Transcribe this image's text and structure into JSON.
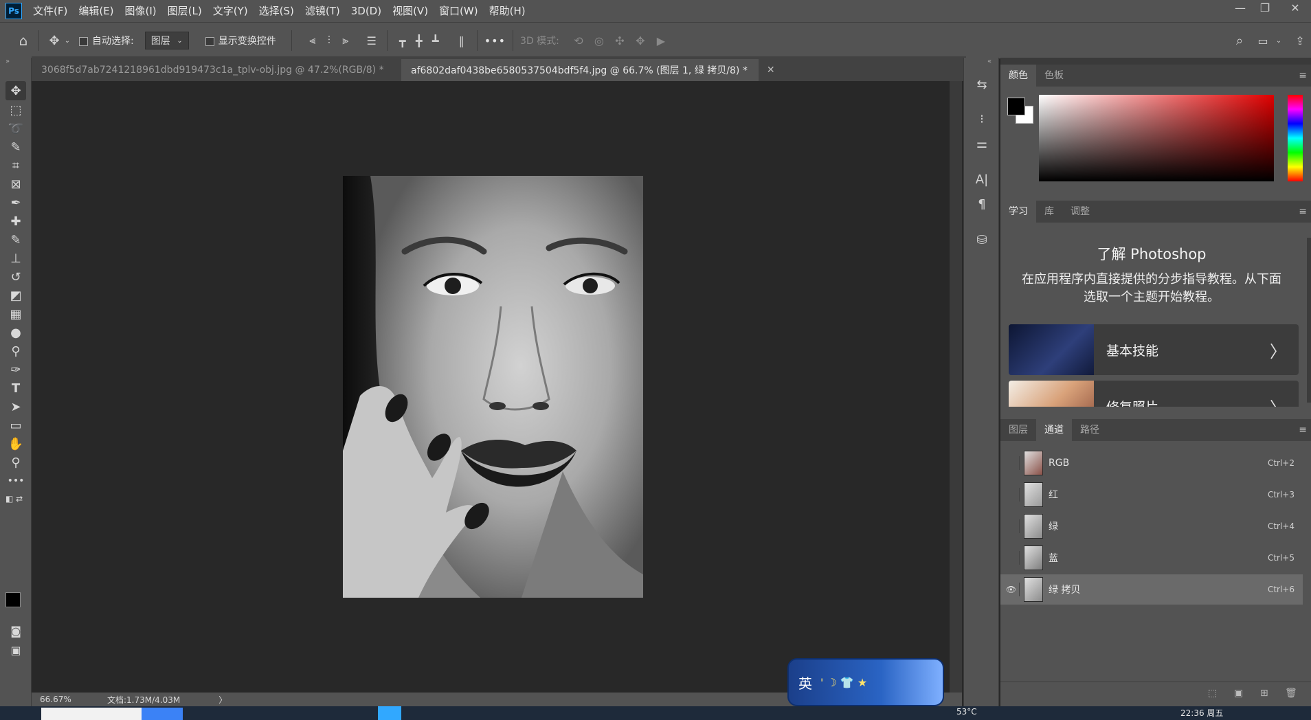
{
  "app": {
    "logo_text": "Ps",
    "menu": [
      "文件(F)",
      "编辑(E)",
      "图像(I)",
      "图层(L)",
      "文字(Y)",
      "选择(S)",
      "滤镜(T)",
      "3D(D)",
      "视图(V)",
      "窗口(W)",
      "帮助(H)"
    ],
    "window_controls": [
      "—",
      "❐",
      "✕"
    ]
  },
  "options_bar": {
    "auto_select_label": "自动选择:",
    "auto_select_value": "图层",
    "show_transform_label": "显示变换控件",
    "mode_3d_label": "3D 模式:",
    "more_glyph": "•••"
  },
  "tabs": [
    {
      "title": "3068f5d7ab7241218961dbd919473c1a_tplv-obj.jpg @ 47.2%(RGB/8) *",
      "close": "✕",
      "active": false
    },
    {
      "title": "af6802daf0438be6580537504bdf5f4.jpg  @ 66.7% (图层 1, 绿 拷贝/8) *",
      "close": "✕",
      "active": true
    }
  ],
  "status": {
    "zoom": "66.67%",
    "doc_info": "文档:1.73M/4.03M",
    "arrow": "〉"
  },
  "color_panel": {
    "tabs": [
      "颜色",
      "色板"
    ],
    "menu_glyph": "≡",
    "foreground": "#000000",
    "background": "#ffffff",
    "picker_hue": "#e00000"
  },
  "learn_panel": {
    "tabs": [
      "学习",
      "库",
      "调整"
    ],
    "menu_glyph": "≡",
    "title": "了解 Photoshop",
    "description": "在应用程序内直接提供的分步指导教程。从下面选取一个主题开始教程。",
    "cards": [
      {
        "label": "基本技能",
        "chevron": "〉"
      },
      {
        "label": "修复照片",
        "chevron": "〉"
      }
    ]
  },
  "channels_panel": {
    "tabs": [
      "图层",
      "通道",
      "路径"
    ],
    "active_tab": "通道",
    "menu_glyph": "≡",
    "rows": [
      {
        "name": "RGB",
        "shortcut": "Ctrl+2",
        "visible": false,
        "selected": false
      },
      {
        "name": "红",
        "shortcut": "Ctrl+3",
        "visible": false,
        "selected": false
      },
      {
        "name": "绿",
        "shortcut": "Ctrl+4",
        "visible": false,
        "selected": false
      },
      {
        "name": "蓝",
        "shortcut": "Ctrl+5",
        "visible": false,
        "selected": false
      },
      {
        "name": "绿 拷贝",
        "shortcut": "Ctrl+6",
        "visible": true,
        "selected": true
      }
    ],
    "eye_glyph": "👁"
  },
  "ime": {
    "lang": "英",
    "glyphs": "' ☽ 👕 ★"
  },
  "taskbar": {
    "temperature": "53°C",
    "time": "22:36 周五"
  }
}
